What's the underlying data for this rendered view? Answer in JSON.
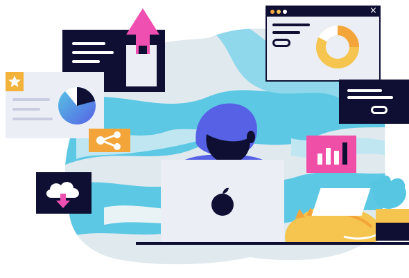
{
  "illustration": {
    "colors": {
      "navy": "#0e0f33",
      "cyan": "#57c6e3",
      "marble_light": "#e4ecf0",
      "pink": "#ef4fb0",
      "magenta_panel": "#f04fa8",
      "orange": "#f3a53a",
      "yellow": "#f5c54f",
      "blue_violet": "#5661e6",
      "card_light": "#eceef6",
      "white": "#ffffff"
    },
    "icons": [
      "star-icon",
      "pie-chart-icon",
      "share-icon",
      "upload-arrow-icon",
      "cloud-download-icon",
      "donut-chart-icon",
      "bar-chart-icon",
      "apple-logo-icon",
      "window-close-icon"
    ],
    "close_glyph": "×",
    "donut_chart_fraction": 0.8,
    "pie_chart_highlight_fraction": 0.3
  }
}
